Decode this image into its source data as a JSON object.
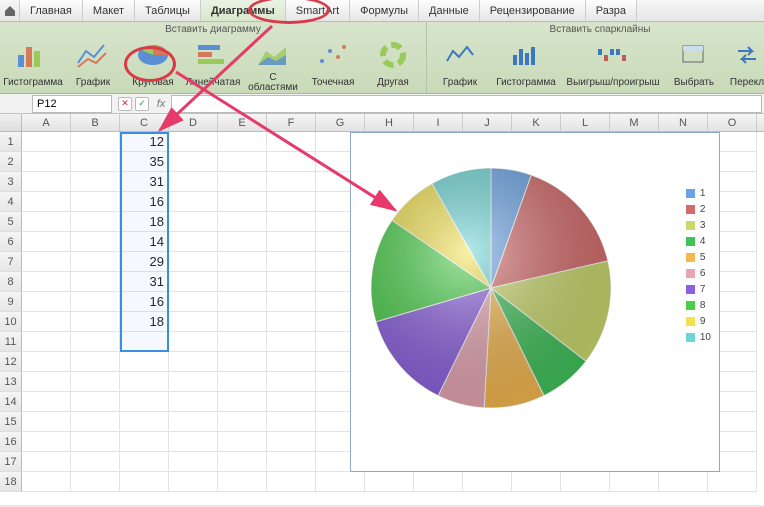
{
  "tabs": {
    "home": "Главная",
    "layout": "Макет",
    "tables": "Таблицы",
    "charts": "Диаграммы",
    "smartart": "SmartArt",
    "formulas": "Формулы",
    "data": "Данные",
    "review": "Рецензирование",
    "dev": "Разра"
  },
  "ribbon": {
    "group_insert": "Вставить диаграмму",
    "group_spark": "Вставить спарклайны",
    "histogram": "Гистограмма",
    "graph": "График",
    "pie": "Круговая",
    "bar": "Линейчатая",
    "area": "С областями",
    "scatter": "Точечная",
    "other": "Другая",
    "spark_line": "График",
    "spark_col": "Гистограмма",
    "spark_winloss": "Выигрыш/проигрыш",
    "select": "Выбрать",
    "switch": "Перекл"
  },
  "namebox": "P12",
  "columns": [
    "A",
    "B",
    "C",
    "D",
    "E",
    "F",
    "G",
    "H",
    "I",
    "J",
    "K",
    "L",
    "M",
    "N",
    "O"
  ],
  "rows": [
    "1",
    "2",
    "3",
    "4",
    "5",
    "6",
    "7",
    "8",
    "9",
    "10",
    "11",
    "12",
    "13",
    "14",
    "15",
    "16",
    "17",
    "18"
  ],
  "cellC": [
    "12",
    "35",
    "31",
    "16",
    "18",
    "14",
    "29",
    "31",
    "16",
    "18"
  ],
  "chart_data": {
    "type": "pie",
    "categories": [
      "1",
      "2",
      "3",
      "4",
      "5",
      "6",
      "7",
      "8",
      "9",
      "10"
    ],
    "values": [
      12,
      35,
      31,
      16,
      18,
      14,
      29,
      31,
      16,
      18
    ],
    "colors": [
      "#6aa4e8",
      "#d66a6a",
      "#c9d96a",
      "#3fc25a",
      "#f5b84e",
      "#e8a6b4",
      "#8b5fe0",
      "#48d048",
      "#f3e24e",
      "#6bd6d6"
    ],
    "title": "",
    "legend_pos": "right"
  },
  "legend_labels": [
    "1",
    "2",
    "3",
    "4",
    "5",
    "6",
    "7",
    "8",
    "9",
    "10"
  ]
}
